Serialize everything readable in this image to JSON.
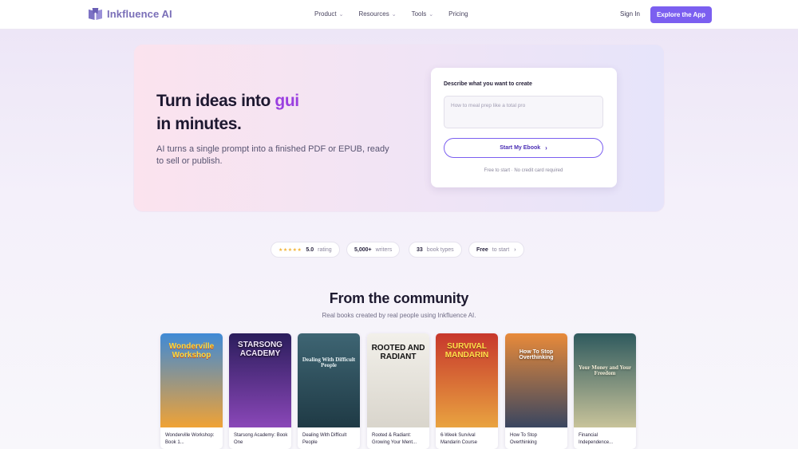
{
  "nav": {
    "brand": "Inkfluence AI",
    "links": [
      "Product",
      "Resources",
      "Tools",
      "Pricing"
    ],
    "signin": "Sign In",
    "cta": "Explore the App"
  },
  "hero": {
    "title_line1": "Turn ideas into ",
    "title_accent": "gui",
    "title_line2": "in minutes.",
    "subtitle": "AI turns a single prompt into a finished PDF or EPUB, ready to sell or publish.",
    "form": {
      "label": "Describe what you want to create",
      "placeholder": "How to meal prep like a total pro",
      "button": "Start My Ebook",
      "note": "Free to start · No credit card required"
    }
  },
  "stats": [
    {
      "icon": "★★★★★",
      "value": "5.0",
      "label": "rating"
    },
    {
      "value": "5,000+",
      "label": "writers"
    },
    {
      "value": "33",
      "label": "book types"
    },
    {
      "value": "Free",
      "label": "to start",
      "arrow": "›"
    }
  ],
  "community": {
    "title": "From the community",
    "subtitle": "Real books created by real people using Inkfluence AI.",
    "books": [
      {
        "name": "Wonderville Workshop: Book 1...",
        "cover_title": "Wonderville Workshop",
        "colors": [
          "#3f8ad6",
          "#f0a235"
        ]
      },
      {
        "name": "Starsong Academy: Book One",
        "cover_title": "STARSONG ACADEMY",
        "colors": [
          "#2b1d5c",
          "#8a47b8"
        ]
      },
      {
        "name": "Dealing With Difficult People",
        "cover_title": "Dealing With Difficult People",
        "colors": [
          "#3e6573",
          "#1f3a45"
        ]
      },
      {
        "name": "Rooted & Radiant: Growing Your Ment...",
        "cover_title": "ROOTED AND RADIANT",
        "colors": [
          "#f2f0ea",
          "#d9d5cc"
        ]
      },
      {
        "name": "6-Week Survival Mandarin Course",
        "cover_title": "SURVIVAL MANDARIN",
        "colors": [
          "#c7372c",
          "#e9a340"
        ]
      },
      {
        "name": "How To Stop Overthinking",
        "cover_title": "How To Stop Overthinking",
        "colors": [
          "#e88a3a",
          "#3a4660"
        ]
      },
      {
        "name": "Financial Independence...",
        "cover_title": "Your Money and Your Freedom",
        "colors": [
          "#2f5a5e",
          "#c8c39a"
        ]
      }
    ]
  },
  "colors": {
    "brand": "#7b5ff0",
    "accent": "#9a3fe0"
  }
}
